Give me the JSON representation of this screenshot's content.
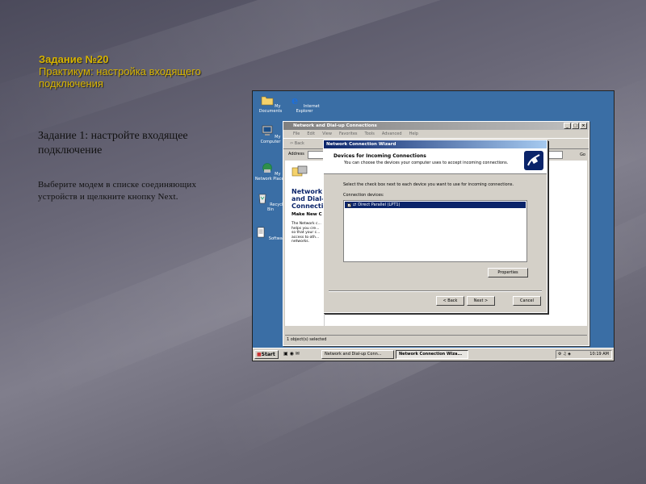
{
  "slide": {
    "title_line1": "Задание №20",
    "title_line2": "Практикум: настройка входящего подключения",
    "task_heading": "Задание 1: настройте входящее подключение",
    "task_text": "Выберите модем в списке соединяющих устройств и щелкните кнопку Next."
  },
  "desktop": {
    "icons": [
      {
        "label": "My Documents",
        "icon": "folder-icon"
      },
      {
        "label": "Internet Explorer",
        "icon": "ie-icon"
      },
      {
        "label": "My Computer",
        "icon": "computer-icon"
      },
      {
        "label": "My Network Places",
        "icon": "network-icon"
      },
      {
        "label": "Recycle Bin",
        "icon": "recycle-bin-icon"
      },
      {
        "label": "Software",
        "icon": "document-icon"
      }
    ]
  },
  "explorer": {
    "title": "Network and Dial-up Connections",
    "menu": [
      "File",
      "Edit",
      "View",
      "Favorites",
      "Tools",
      "Advanced",
      "Help"
    ],
    "back_label": "Back",
    "address_label": "Address",
    "go_label": "Go",
    "pane_heading": "Network and Dial-up Connections",
    "pane_subheading": "Make New C",
    "pane_text": "The Network c... helps you cre... so that your c... access to oth... networks.",
    "status": "1 object(s) selected"
  },
  "wizard": {
    "title": "Network Connection Wizard",
    "heading": "Devices for Incoming Connections",
    "subheading": "You can choose the devices your computer uses to accept incoming connections.",
    "instruction": "Select the check box next to each device you want to use for incoming connections.",
    "devices_label": "Connection devices:",
    "devices": [
      {
        "name": "Direct Parallel (LPT1)",
        "checked": true,
        "selected": true
      }
    ],
    "properties_label": "Properties",
    "back_label": "< Back",
    "next_label": "Next >",
    "cancel_label": "Cancel"
  },
  "taskbar": {
    "start_label": "Start",
    "tasks": [
      "Network and Dial-up Conn...",
      "Network Connection Wiza..."
    ],
    "clock": "10:19 AM"
  },
  "colors": {
    "title_color": "#d8b400",
    "desktop_bg": "#3a6ea5",
    "active_title": "#0a246a"
  }
}
